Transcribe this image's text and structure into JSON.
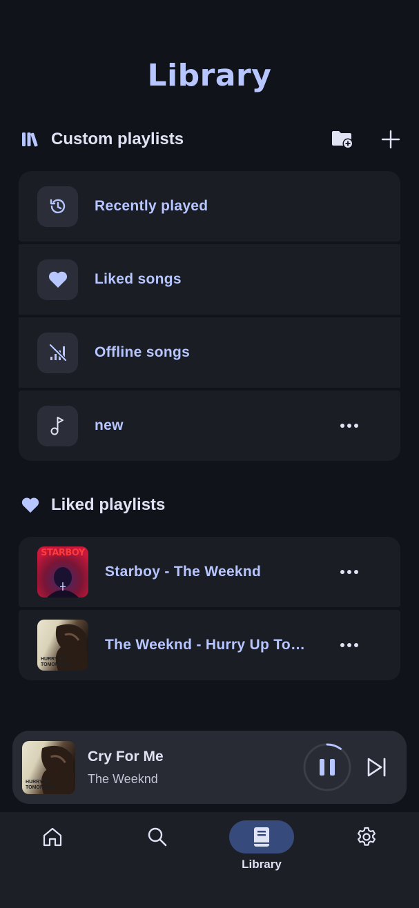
{
  "page": {
    "title": "Library"
  },
  "custom_section": {
    "label": "Custom playlists",
    "actions": [
      {
        "name": "new-folder-icon"
      },
      {
        "name": "add-icon"
      }
    ],
    "items": [
      {
        "label": "Recently played",
        "icon": "history-icon"
      },
      {
        "label": "Liked songs",
        "icon": "heart-icon"
      },
      {
        "label": "Offline songs",
        "icon": "signal-off-icon"
      },
      {
        "label": "new",
        "icon": "music-note-icon"
      }
    ]
  },
  "liked_section": {
    "label": "Liked playlists",
    "items": [
      {
        "label": "Starboy - The Weeknd",
        "art_text": "STARBOY"
      },
      {
        "label": "The Weeknd - Hurry Up Tomorrow",
        "art_text": "HURRY UP TOMORROW"
      }
    ]
  },
  "mini_player": {
    "title": "Cry For Me",
    "artist": "The Weeknd",
    "art_text": "HURRY UP TOMORROW",
    "progress": 0.1
  },
  "nav": {
    "items": [
      {
        "label": "",
        "icon": "home-icon"
      },
      {
        "label": "",
        "icon": "search-icon"
      },
      {
        "label": "Library",
        "icon": "library-book-icon"
      },
      {
        "label": "",
        "icon": "settings-gear-icon"
      }
    ]
  },
  "colors": {
    "background": "#11131a",
    "surface": "#1b1d25",
    "accent": "#b7c6ff",
    "active_pill": "#374a7c"
  }
}
